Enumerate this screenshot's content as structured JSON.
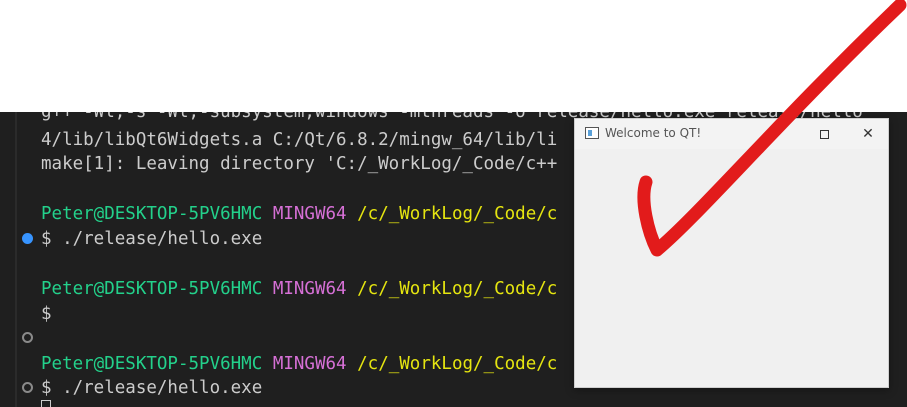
{
  "terminal": {
    "lines": {
      "l1": "g++ -Wl,-s -Wl,-subsystem,windows -mthreads -o release/hello.exe release/hello",
      "l2": "4/lib/libQt6Widgets.a C:/Qt/6.8.2/mingw_64/lib/li",
      "l3": "make[1]: Leaving directory 'C:/_WorkLog/_Code/c++",
      "l5_user": "Peter@DESKTOP-5PV6HMC",
      "l5_host": "MINGW64",
      "l5_path": "/c/_WorkLog/_Code/c",
      "l6": "$ ./release/hello.exe",
      "l8_user": "Peter@DESKTOP-5PV6HMC",
      "l8_host": "MINGW64",
      "l8_path": "/c/_WorkLog/_Code/c",
      "l9": "$",
      "l11_user": "Peter@DESKTOP-5PV6HMC",
      "l11_host": "MINGW64",
      "l11_path": "/c/_WorkLog/_Code/c",
      "l12": "$ ./release/hello.exe"
    },
    "colors": {
      "background": "#1f1f1f",
      "user": "#23d18b",
      "host": "#d670d6",
      "path": "#e5e510",
      "text": "#cccccc",
      "marker_success": "#3794ff"
    }
  },
  "window": {
    "title": "Welcome to QT!",
    "minimize_icon": "minimize-icon",
    "maximize_icon": "maximize-icon",
    "close_icon": "close-icon",
    "close_glyph": "✕"
  },
  "annotation": {
    "icon": "checkmark-icon",
    "color": "#e21b1b"
  }
}
